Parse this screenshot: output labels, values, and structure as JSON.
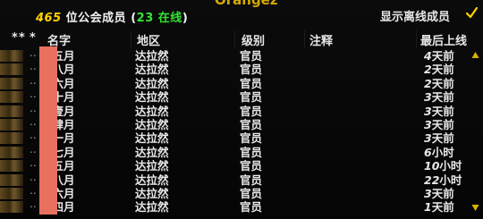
{
  "header": {
    "guild_name": "Orangez",
    "member_count": "465",
    "members_label": "位公会成员",
    "paren_open": "(",
    "online_count": "23",
    "online_label": "在线",
    "paren_close": ")",
    "show_offline_label": "显示离线成员",
    "show_offline_checked": true
  },
  "columns": {
    "sort_markers": [
      "*",
      "*",
      "*"
    ],
    "name": "名字",
    "zone": "地区",
    "rank": "级别",
    "note": "注释",
    "last_online": "最后上线"
  },
  "rows": [
    {
      "dots": "..",
      "name": "肆五月",
      "zone": "达拉然",
      "rank": "官员",
      "num": "4",
      "unit": "天前"
    },
    {
      "dots": "..",
      "name": "捌八月",
      "zone": "达拉然",
      "rank": "官员",
      "num": "2",
      "unit": "天前"
    },
    {
      "dots": "..",
      "name": "陆六月",
      "zone": "达拉然",
      "rank": "官员",
      "num": "2",
      "unit": "天前"
    },
    {
      "dots": "..",
      "name": "拾十月",
      "zone": "达拉然",
      "rank": "官员",
      "num": "3",
      "unit": "天前"
    },
    {
      "dots": "..",
      "name": "拾壹月",
      "zone": "达拉然",
      "rank": "官员",
      "num": "3",
      "unit": "天前"
    },
    {
      "dots": "..",
      "name": "肆肆月",
      "zone": "达拉然",
      "rank": "官员",
      "num": "3",
      "unit": "天前"
    },
    {
      "dots": "..",
      "name": "十一月",
      "zone": "达拉然",
      "rank": "官员",
      "num": "3",
      "unit": "天前"
    },
    {
      "dots": "..",
      "name": "十七月",
      "zone": "达拉然",
      "rank": "官员",
      "num": "6",
      "unit": "小时"
    },
    {
      "dots": "..",
      "name": "十五月",
      "zone": "达拉然",
      "rank": "官员",
      "num": "10",
      "unit": "小时"
    },
    {
      "dots": "..",
      "name": "十八月",
      "zone": "达拉然",
      "rank": "官员",
      "num": "22",
      "unit": "小时"
    },
    {
      "dots": "..",
      "name": "十六月",
      "zone": "达拉然",
      "rank": "官员",
      "num": "3",
      "unit": "天前"
    },
    {
      "dots": "..",
      "name": "十四月",
      "zone": "达拉然",
      "rank": "官员",
      "num": "1",
      "unit": "天前"
    }
  ],
  "colors": {
    "guild_name": "#d4a900",
    "count": "#ffd200",
    "online": "#32e632",
    "redaction": "#e8705f",
    "scroll_arrow": "#d6b400"
  },
  "icons": {
    "scroll_up": "triangle-up-icon",
    "scroll_down": "triangle-down-icon",
    "checkbox": "checkmark-icon",
    "row_icon": "guild-rank-icon"
  }
}
